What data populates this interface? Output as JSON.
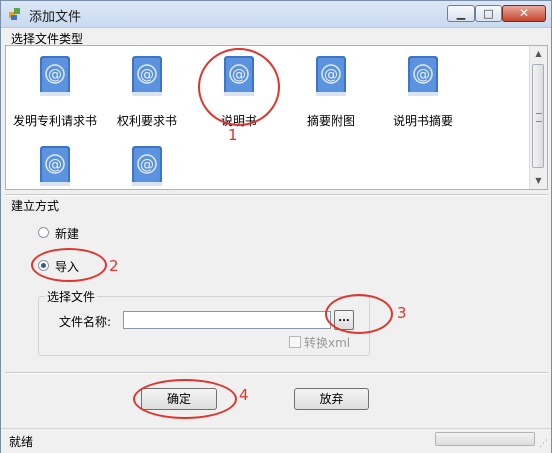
{
  "window": {
    "title": "添加文件",
    "controls": {
      "minimize": "▁",
      "maximize": "□",
      "close": "✕"
    }
  },
  "filetype_group": {
    "label": "选择文件类型",
    "items": [
      {
        "label": "发明专利请求书",
        "icon": "book-at-icon"
      },
      {
        "label": "权利要求书",
        "icon": "book-at-icon"
      },
      {
        "label": "说明书",
        "icon": "book-at-icon",
        "selected": true
      },
      {
        "label": "摘要附图",
        "icon": "book-at-icon"
      },
      {
        "label": "说明书摘要",
        "icon": "book-at-icon"
      },
      {
        "label": "",
        "icon": "book-at-icon"
      },
      {
        "label": "",
        "icon": "book-at-icon"
      }
    ]
  },
  "create_mode": {
    "label": "建立方式",
    "options": [
      {
        "label": "新建",
        "checked": false
      },
      {
        "label": "导入",
        "checked": true
      }
    ]
  },
  "file_select": {
    "label": "选择文件",
    "file_name_label": "文件名称:",
    "file_name_value": "",
    "browse_label": "...",
    "convert_label": "转换xml",
    "convert_checked": false,
    "convert_enabled": false
  },
  "buttons": {
    "ok": "确定",
    "cancel": "放弃"
  },
  "status": {
    "text": "就绪"
  },
  "annotations": [
    "1",
    "2",
    "3",
    "4"
  ],
  "colors": {
    "annotation": "#e0342c",
    "book": "#3d73c9",
    "title_bar": "#c9daf0"
  }
}
